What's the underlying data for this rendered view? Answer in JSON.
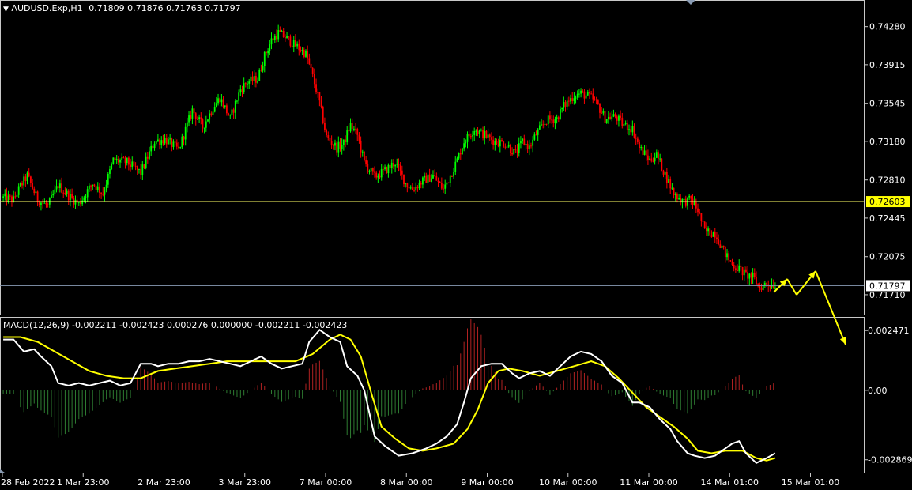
{
  "header": {
    "symbol": "AUDUSD.Exp,H1",
    "ohlc": "0.71809 0.71876 0.71763 0.71797"
  },
  "macd_header": "MACD(12,26,9) -0.002211 -0.002423 0.000276 0.000000 -0.002211 -0.002423",
  "colors": {
    "background": "#000000",
    "bull": "#00ff00",
    "bear": "#ff0000",
    "hline": "#ffff66",
    "price_line": "#8a9cb4",
    "macd_main": "#ffffff",
    "macd_signal": "#ffff00",
    "hist_pos": "#b22222",
    "hist_neg": "#2e7d32",
    "arrow": "#ffff00"
  },
  "chart_data": [
    {
      "type": "candlestick",
      "symbol": "AUDUSD.Exp,H1",
      "yticks": [
        "0.74280",
        "0.73915",
        "0.73545",
        "0.73180",
        "0.72810",
        "0.72445",
        "0.72075",
        "0.71710"
      ],
      "ylim": [
        0.7152,
        0.7452
      ],
      "xticks": [
        "28 Feb 2022",
        "1 Mar 23:00",
        "2 Mar 23:00",
        "3 Mar 23:00",
        "7 Mar 00:00",
        "8 Mar 00:00",
        "9 Mar 00:00",
        "10 Mar 00:00",
        "11 Mar 00:00",
        "14 Mar 01:00",
        "15 Mar 01:00"
      ],
      "horizontal_line": {
        "value": 0.72603,
        "label": "0.72603"
      },
      "current_price": {
        "value": 0.71797,
        "label": "0.71797"
      },
      "close_path": [
        [
          0,
          0.7264
        ],
        [
          6,
          0.7262
        ],
        [
          10,
          0.7275
        ],
        [
          14,
          0.7285
        ],
        [
          20,
          0.7262
        ],
        [
          26,
          0.7256
        ],
        [
          32,
          0.7276
        ],
        [
          38,
          0.7266
        ],
        [
          44,
          0.7258
        ],
        [
          52,
          0.7278
        ],
        [
          58,
          0.7268
        ],
        [
          64,
          0.73
        ],
        [
          72,
          0.7298
        ],
        [
          80,
          0.7288
        ],
        [
          88,
          0.7318
        ],
        [
          94,
          0.732
        ],
        [
          102,
          0.731
        ],
        [
          110,
          0.7348
        ],
        [
          116,
          0.7332
        ],
        [
          122,
          0.735
        ],
        [
          126,
          0.736
        ],
        [
          132,
          0.734
        ],
        [
          138,
          0.7368
        ],
        [
          142,
          0.7375
        ],
        [
          148,
          0.7378
        ],
        [
          152,
          0.74
        ],
        [
          156,
          0.7415
        ],
        [
          160,
          0.7422
        ],
        [
          164,
          0.7418
        ],
        [
          170,
          0.741
        ],
        [
          176,
          0.7402
        ],
        [
          180,
          0.738
        ],
        [
          184,
          0.7355
        ],
        [
          188,
          0.7322
        ],
        [
          194,
          0.7312
        ],
        [
          198,
          0.7316
        ],
        [
          202,
          0.7334
        ],
        [
          206,
          0.7324
        ],
        [
          210,
          0.7298
        ],
        [
          216,
          0.7284
        ],
        [
          222,
          0.729
        ],
        [
          228,
          0.7298
        ],
        [
          234,
          0.7278
        ],
        [
          238,
          0.7272
        ],
        [
          244,
          0.728
        ],
        [
          250,
          0.7285
        ],
        [
          256,
          0.7272
        ],
        [
          260,
          0.7285
        ],
        [
          264,
          0.73
        ],
        [
          268,
          0.7318
        ],
        [
          274,
          0.733
        ],
        [
          280,
          0.7324
        ],
        [
          286,
          0.7318
        ],
        [
          292,
          0.7316
        ],
        [
          298,
          0.7306
        ],
        [
          302,
          0.7318
        ],
        [
          306,
          0.7312
        ],
        [
          310,
          0.7325
        ],
        [
          316,
          0.7338
        ],
        [
          322,
          0.734
        ],
        [
          326,
          0.7352
        ],
        [
          332,
          0.7362
        ],
        [
          336,
          0.7364
        ],
        [
          342,
          0.736
        ],
        [
          346,
          0.7352
        ],
        [
          350,
          0.734
        ],
        [
          356,
          0.7342
        ],
        [
          360,
          0.7335
        ],
        [
          366,
          0.733
        ],
        [
          370,
          0.7312
        ],
        [
          376,
          0.73
        ],
        [
          380,
          0.7305
        ],
        [
          384,
          0.729
        ],
        [
          390,
          0.7268
        ],
        [
          396,
          0.726
        ],
        [
          400,
          0.7262
        ],
        [
          404,
          0.7252
        ],
        [
          408,
          0.7232
        ],
        [
          414,
          0.723
        ],
        [
          420,
          0.721
        ],
        [
          424,
          0.72
        ],
        [
          428,
          0.7196
        ],
        [
          432,
          0.719
        ],
        [
          436,
          0.7188
        ],
        [
          440,
          0.7178
        ],
        [
          444,
          0.7182
        ],
        [
          449,
          0.718
        ]
      ]
    },
    {
      "type": "macd",
      "label": "MACD(12,26,9)",
      "yticks": [
        "0.002471",
        "0.00",
        "-0.002869"
      ],
      "ylim": [
        -0.0034,
        0.003
      ],
      "main": [
        [
          0,
          0.0021
        ],
        [
          6,
          0.0021
        ],
        [
          12,
          0.0016
        ],
        [
          18,
          0.0017
        ],
        [
          22,
          0.0014
        ],
        [
          28,
          0.001
        ],
        [
          32,
          0.0003
        ],
        [
          38,
          0.0002
        ],
        [
          44,
          0.0003
        ],
        [
          50,
          0.0002
        ],
        [
          56,
          0.0003
        ],
        [
          62,
          0.0004
        ],
        [
          68,
          0.0002
        ],
        [
          74,
          0.0003
        ],
        [
          80,
          0.0011
        ],
        [
          86,
          0.0011
        ],
        [
          90,
          0.001
        ],
        [
          96,
          0.0011
        ],
        [
          102,
          0.0011
        ],
        [
          108,
          0.0012
        ],
        [
          114,
          0.0012
        ],
        [
          120,
          0.0013
        ],
        [
          126,
          0.0012
        ],
        [
          132,
          0.0011
        ],
        [
          138,
          0.001
        ],
        [
          144,
          0.0012
        ],
        [
          150,
          0.0014
        ],
        [
          156,
          0.0011
        ],
        [
          162,
          0.0009
        ],
        [
          168,
          0.001
        ],
        [
          174,
          0.0011
        ],
        [
          178,
          0.002
        ],
        [
          184,
          0.0025
        ],
        [
          190,
          0.0022
        ],
        [
          196,
          0.002
        ],
        [
          200,
          0.001
        ],
        [
          206,
          0.0006
        ],
        [
          210,
          0.0
        ],
        [
          216,
          -0.0019
        ],
        [
          222,
          -0.0023
        ],
        [
          230,
          -0.0027
        ],
        [
          238,
          -0.0026
        ],
        [
          246,
          -0.0024
        ],
        [
          252,
          -0.0022
        ],
        [
          258,
          -0.0019
        ],
        [
          264,
          -0.0014
        ],
        [
          268,
          -0.0005
        ],
        [
          272,
          0.0005
        ],
        [
          278,
          0.001
        ],
        [
          284,
          0.0011
        ],
        [
          290,
          0.0011
        ],
        [
          296,
          0.0007
        ],
        [
          300,
          0.0005
        ],
        [
          306,
          0.0007
        ],
        [
          312,
          0.0008
        ],
        [
          318,
          0.0006
        ],
        [
          324,
          0.001
        ],
        [
          330,
          0.0014
        ],
        [
          336,
          0.0016
        ],
        [
          342,
          0.0015
        ],
        [
          348,
          0.0012
        ],
        [
          354,
          0.0006
        ],
        [
          360,
          0.0003
        ],
        [
          366,
          -0.0005
        ],
        [
          370,
          -0.0005
        ],
        [
          376,
          -0.0007
        ],
        [
          382,
          -0.0012
        ],
        [
          388,
          -0.0016
        ],
        [
          392,
          -0.0021
        ],
        [
          398,
          -0.0026
        ],
        [
          402,
          -0.0027
        ],
        [
          408,
          -0.0028
        ],
        [
          414,
          -0.0027
        ],
        [
          418,
          -0.0025
        ],
        [
          424,
          -0.0022
        ],
        [
          428,
          -0.0021
        ],
        [
          432,
          -0.0026
        ],
        [
          438,
          -0.003
        ],
        [
          444,
          -0.0028
        ],
        [
          449,
          -0.0026
        ]
      ],
      "signal": [
        [
          0,
          0.0022
        ],
        [
          10,
          0.0022
        ],
        [
          20,
          0.002
        ],
        [
          30,
          0.0016
        ],
        [
          40,
          0.0012
        ],
        [
          50,
          0.0008
        ],
        [
          60,
          0.0006
        ],
        [
          70,
          0.0005
        ],
        [
          80,
          0.0005
        ],
        [
          90,
          0.0008
        ],
        [
          100,
          0.0009
        ],
        [
          110,
          0.001
        ],
        [
          120,
          0.0011
        ],
        [
          130,
          0.0012
        ],
        [
          140,
          0.0012
        ],
        [
          150,
          0.0012
        ],
        [
          160,
          0.0012
        ],
        [
          170,
          0.0012
        ],
        [
          180,
          0.0015
        ],
        [
          190,
          0.0021
        ],
        [
          196,
          0.0023
        ],
        [
          202,
          0.0021
        ],
        [
          208,
          0.0014
        ],
        [
          214,
          -0.0001
        ],
        [
          220,
          -0.0015
        ],
        [
          228,
          -0.002
        ],
        [
          236,
          -0.0024
        ],
        [
          244,
          -0.0025
        ],
        [
          252,
          -0.0024
        ],
        [
          262,
          -0.0022
        ],
        [
          270,
          -0.0016
        ],
        [
          276,
          -0.0008
        ],
        [
          282,
          0.0003
        ],
        [
          288,
          0.0008
        ],
        [
          294,
          0.0009
        ],
        [
          302,
          0.0008
        ],
        [
          312,
          0.0006
        ],
        [
          322,
          0.0008
        ],
        [
          332,
          0.001
        ],
        [
          342,
          0.0012
        ],
        [
          350,
          0.001
        ],
        [
          358,
          0.0005
        ],
        [
          366,
          -0.0001
        ],
        [
          374,
          -0.0007
        ],
        [
          382,
          -0.0011
        ],
        [
          390,
          -0.0015
        ],
        [
          398,
          -0.002
        ],
        [
          404,
          -0.0025
        ],
        [
          412,
          -0.0026
        ],
        [
          420,
          -0.0025
        ],
        [
          430,
          -0.0025
        ],
        [
          438,
          -0.0028
        ],
        [
          444,
          -0.0029
        ],
        [
          449,
          -0.0028
        ]
      ]
    }
  ]
}
